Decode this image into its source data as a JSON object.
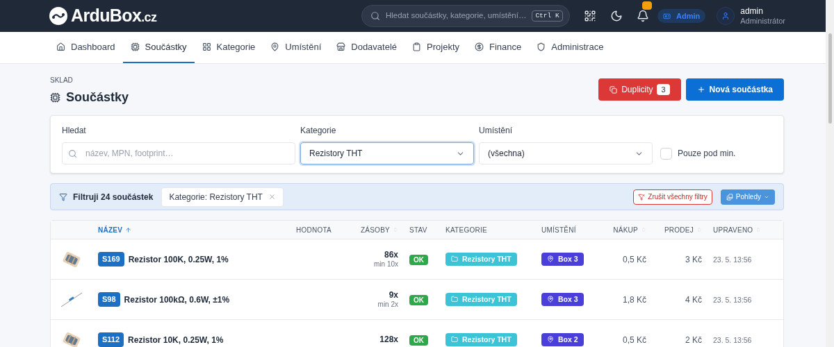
{
  "header": {
    "logo": {
      "name": "ArduBox",
      "suffix": ".cz"
    },
    "search": {
      "placeholder": "Hledat součástky, kategorie, umístění…",
      "shortcut": "Ctrl K"
    },
    "notifications": {
      "unread": true
    },
    "role_badge": "Admin",
    "user": {
      "name": "admin",
      "role": "Administrátor"
    }
  },
  "nav": [
    {
      "label": "Dashboard",
      "selected": false
    },
    {
      "label": "Součástky",
      "selected": true
    },
    {
      "label": "Kategorie",
      "selected": false
    },
    {
      "label": "Umístění",
      "selected": false
    },
    {
      "label": "Dodavatelé",
      "selected": false
    },
    {
      "label": "Projekty",
      "selected": false
    },
    {
      "label": "Finance",
      "selected": false
    },
    {
      "label": "Administrace",
      "selected": false
    }
  ],
  "page": {
    "overline": "SKLAD",
    "title": "Součástky",
    "duplicates_button": {
      "label": "Duplicity",
      "count": "3"
    },
    "new_button": "Nová součástka"
  },
  "filters": {
    "search": {
      "label": "Hledat",
      "placeholder": "název, MPN, footprint…"
    },
    "category": {
      "label": "Kategorie",
      "value": "Rezistory THT",
      "focused": true
    },
    "location": {
      "label": "Umístění",
      "value": "(všechna)",
      "focused": false
    },
    "below_min": {
      "label": "Pouze pod min.",
      "checked": false
    }
  },
  "filter_bar": {
    "summary": "Filtruji 24 součástek",
    "chips": [
      "Kategorie: Rezistory THT"
    ],
    "clear_button": "Zrušit všechny filtry",
    "views_button": "Pohledy"
  },
  "table": {
    "columns": [
      {
        "label": "NÁZEV",
        "selected": true,
        "sortable": true
      },
      {
        "label": "HODNOTA",
        "selected": false,
        "sortable": false
      },
      {
        "label": "ZÁSOBY",
        "selected": false,
        "sortable": true
      },
      {
        "label": "STAV",
        "selected": false,
        "sortable": false
      },
      {
        "label": "KATEGORIE",
        "selected": false,
        "sortable": false
      },
      {
        "label": "UMÍSTĚNÍ",
        "selected": false,
        "sortable": false
      },
      {
        "label": "NÁKUP",
        "selected": false,
        "sortable": true
      },
      {
        "label": "PRODEJ",
        "selected": false,
        "sortable": true
      },
      {
        "label": "UPRAVENO",
        "selected": false,
        "sortable": true
      }
    ],
    "rows": [
      {
        "kind": "reel",
        "code": "S169",
        "name": "Rezistor 100K, 0.25W, 1%",
        "stock": "86x",
        "min": "min 10x",
        "status": "OK",
        "category": "Rezistory THT",
        "location": "Box 3",
        "buy": "0,5 Kč",
        "sell": "3 Kč",
        "updated": "23. 5. 13:56"
      },
      {
        "kind": "single",
        "code": "S98",
        "name": "Rezistor 100kΩ, 0.6W, ±1%",
        "stock": "9x",
        "min": "min 2x",
        "status": "OK",
        "category": "Rezistory THT",
        "location": "Box 3",
        "buy": "1,8 Kč",
        "sell": "4 Kč",
        "updated": "23. 5. 13:56"
      },
      {
        "kind": "reel",
        "code": "S112",
        "name": "Rezistor 10K, 0.25W, 1%",
        "stock": "128x",
        "status": "OK",
        "category": "Rezistory THT",
        "location": "Box 2",
        "buy": "0,5 Kč",
        "sell": "2 Kč",
        "updated": "23. 5. 13:56"
      }
    ]
  }
}
